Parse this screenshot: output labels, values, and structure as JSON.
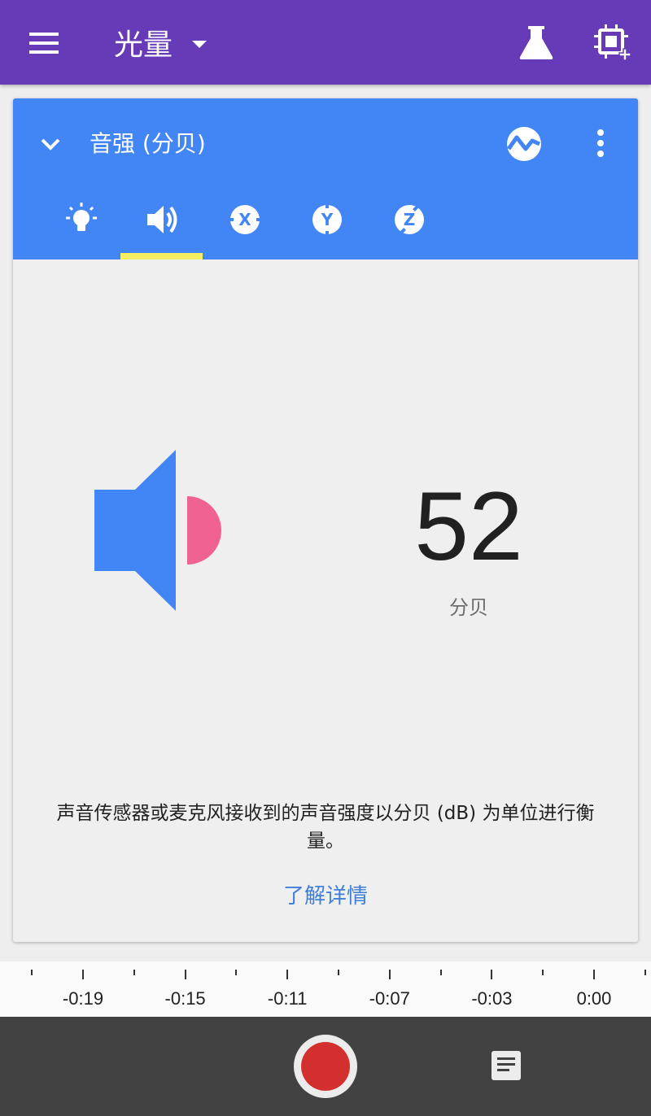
{
  "app_bar": {
    "title": "光量",
    "background": "#673ab7",
    "icons": [
      "menu-icon",
      "dropdown-caret-icon",
      "flask-icon",
      "add-sensor-icon"
    ]
  },
  "sensor_card": {
    "title": "音强 (分贝)",
    "header_color": "#4285f4",
    "icons": [
      "chevron-down-icon",
      "graph-icon",
      "more-vert-icon"
    ],
    "tabs": [
      {
        "name": "light",
        "icon": "lightbulb-icon",
        "selected": false
      },
      {
        "name": "sound",
        "icon": "volume-icon",
        "selected": true
      },
      {
        "name": "x",
        "icon": "x-axis-icon",
        "label": "X",
        "selected": false
      },
      {
        "name": "y",
        "icon": "y-axis-icon",
        "label": "Y",
        "selected": false
      },
      {
        "name": "z",
        "icon": "z-axis-icon",
        "label": "Z",
        "selected": false
      }
    ],
    "selected_tab_indicator_color": "#f4ee62",
    "reading": {
      "value": "52",
      "unit": "分贝"
    },
    "graphic_colors": {
      "speaker": "#4285f4",
      "sound_wave": "#f06292"
    },
    "description": "声音传感器或麦克风接收到的声音强度以分贝 (dB) 为单位进行衡量。",
    "learn_more": "了解详情"
  },
  "timeline": {
    "labels": [
      "-0:19",
      "-0:15",
      "-0:11",
      "-0:07",
      "-0:03",
      "0:00"
    ]
  },
  "bottom_bar": {
    "icons": [
      "record-icon",
      "notes-icon"
    ],
    "record_color": "#d32f2f"
  }
}
